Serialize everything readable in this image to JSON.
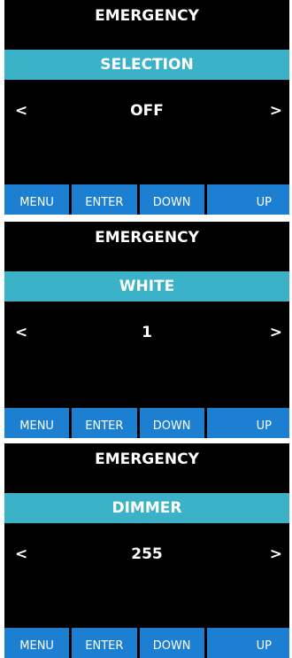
{
  "screens": [
    {
      "title": "EMERGENCY",
      "band": "SELECTION",
      "value": "OFF",
      "left_arrow": "<",
      "right_arrow": ">",
      "buttons": [
        "MENU",
        "ENTER",
        "DOWN",
        "UP"
      ]
    },
    {
      "title": "EMERGENCY",
      "band": "WHITE",
      "value": "1",
      "left_arrow": "<",
      "right_arrow": ">",
      "buttons": [
        "MENU",
        "ENTER",
        "DOWN",
        "UP"
      ]
    },
    {
      "title": "EMERGENCY",
      "band": "DIMMER",
      "value": "255",
      "left_arrow": "<",
      "right_arrow": ">",
      "buttons": [
        "MENU",
        "ENTER",
        "DOWN",
        "UP"
      ]
    }
  ],
  "colors": {
    "screen_bg": "#000000",
    "band": "#3cb2c8",
    "button": "#1d7fd1",
    "text": "#ffffff"
  }
}
